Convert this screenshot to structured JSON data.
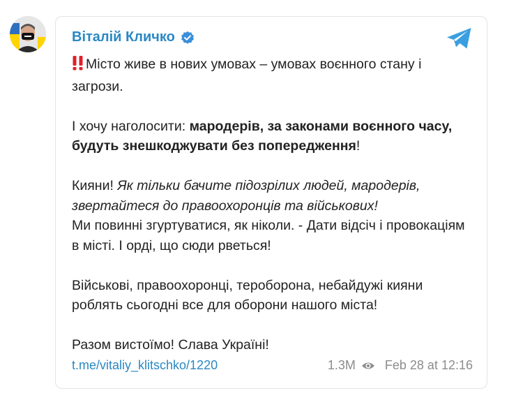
{
  "post": {
    "author": "Віталій Кличко",
    "paragraphs": {
      "p1": {
        "emoji": "‼️",
        "text": "Місто живе в нових умовах – умовах воєнного стану і загрози."
      },
      "p2": {
        "intro": "І хочу наголосити: ",
        "bold": "мародерів, за законами воєнного часу, будуть знешкоджувати без попередження",
        "end": "!"
      },
      "p3": {
        "lead": "Кияни! ",
        "italic": "Як тільки бачите підозрілих людей, мародерів, звертайтеся до правоохоронців та військових!",
        "rest": "Ми повинні згуртуватися, як ніколи. - Дати відсіч і провокаціям в місті. І орді, що сюди рветься!"
      },
      "p4": "Військові, правоохоронці, тероборона, небайдужі кияни роблять сьогодні все для оборони нашого міста!",
      "p5": "Разом вистоїмо! Слава Україні!"
    },
    "link": "t.me/vitaliy_klitschko/1220",
    "views": "1.3M",
    "date": "Feb 28 at 12:16"
  },
  "icons": {
    "verified": "verified-badge-icon",
    "telegram": "telegram-plane-icon",
    "views": "eye-icon"
  },
  "colors": {
    "accent": "#2a88c4",
    "verified": "#3a8fd9",
    "exclamation": "#e0202a",
    "meta": "#8c8c8c"
  }
}
